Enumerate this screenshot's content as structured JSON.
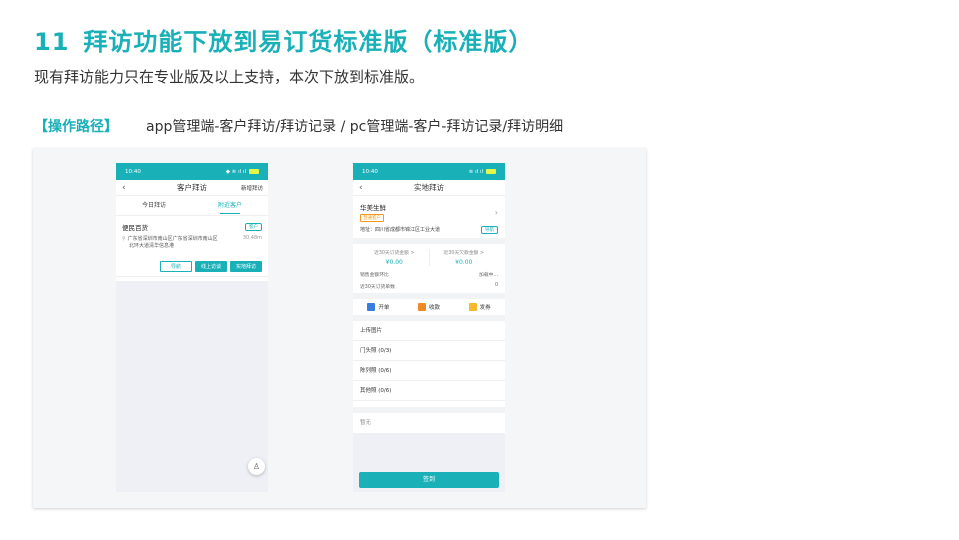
{
  "header": {
    "number": "11",
    "title": "拜访功能下放到易订货标准版（标准版）",
    "subtitle": "现有拜访能力只在专业版及以上支持，本次下放到标准版。",
    "path_label": "【操作路径】",
    "path_text": "app管理端-客户拜访/拜访记录 / pc管理端-客户-拜访记录/拜访明细"
  },
  "colors": {
    "accent": "#1ab0b8",
    "orange": "#f39b20"
  },
  "phone1": {
    "time": "10:40",
    "title": "客户拜访",
    "right_action": "新增拜访",
    "tabs": [
      "今日拜访",
      "附近客户"
    ],
    "active_tab": 1,
    "customer": {
      "name": "便民百货",
      "tag": "客户",
      "address_line1": "广东省深圳市南山区广东省深圳市南山区",
      "address_line2": "北环大道清华信息港",
      "distance": "30.48m"
    },
    "buttons": {
      "navigate": "导航",
      "online": "线上访谈",
      "visit": "实地拜访"
    },
    "fab_icon": "visitor-icon"
  },
  "phone2": {
    "time": "10:40",
    "title": "实地拜访",
    "store": {
      "name": "华美生鲜",
      "type": "普通客户",
      "address": "地址：四川省成都市锦江区工业大道",
      "nav": "导航"
    },
    "amounts": [
      {
        "label": "近30天订货金额 >",
        "value": "¥0.00"
      },
      {
        "label": "近30天欠款金额 >",
        "value": "¥0.00"
      }
    ],
    "stats": [
      {
        "label": "销售金额环比",
        "value": "加载中..."
      },
      {
        "label": "近30天订货单数",
        "value": "0"
      }
    ],
    "actions": [
      {
        "label": "开单",
        "icon": "order-icon",
        "color": "#3a7be0"
      },
      {
        "label": "收款",
        "icon": "payment-icon",
        "color": "#f08a24"
      },
      {
        "label": "发券",
        "icon": "coupon-icon",
        "color": "#f5b82e"
      }
    ],
    "photos_title": "上传图片",
    "photos": [
      "门头照 (0/3)",
      "陈列照 (0/6)",
      "其他照 (0/6)"
    ],
    "note": "暂无",
    "sign_button": "签到"
  }
}
